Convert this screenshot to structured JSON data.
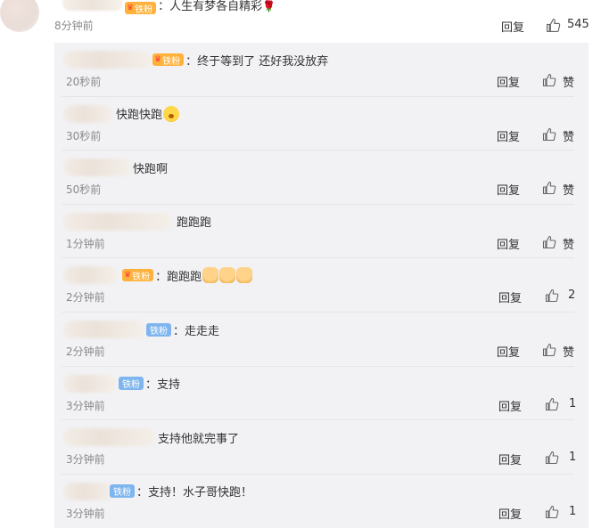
{
  "top_comment": {
    "badge": "铁粉",
    "text": "：人生有梦各自精彩",
    "emoji": "rose",
    "time": "8分钟前",
    "reply_label": "回复",
    "like_count": "545"
  },
  "replies": [
    {
      "badge_type": "fan",
      "badge": "铁粉",
      "text": "：终于等到了 还好我没放弃",
      "time": "20秒前",
      "reply_label": "回复",
      "like": "赞"
    },
    {
      "badge_type": "none",
      "text": "快跑快跑",
      "time": "30秒前",
      "reply_label": "回复",
      "like": "赞"
    },
    {
      "badge_type": "none",
      "text": "快跑啊",
      "time": "50秒前",
      "reply_label": "回复",
      "like": "赞"
    },
    {
      "badge_type": "none",
      "text": "跑跑跑",
      "time": "1分钟前",
      "reply_label": "回复",
      "like": "赞"
    },
    {
      "badge_type": "fan",
      "badge": "铁粉",
      "text": "：跑跑跑",
      "time": "2分钟前",
      "reply_label": "回复",
      "like": "2"
    },
    {
      "badge_type": "blue",
      "badge": "铁粉",
      "text": "：走走走",
      "time": "2分钟前",
      "reply_label": "回复",
      "like": "赞"
    },
    {
      "badge_type": "blue",
      "badge": "铁粉",
      "text": "：支持",
      "time": "3分钟前",
      "reply_label": "回复",
      "like": "1"
    },
    {
      "badge_type": "none",
      "text": "支持他就完事了",
      "time": "3分钟前",
      "reply_label": "回复",
      "like": "1"
    },
    {
      "badge_type": "blue",
      "badge": "铁粉",
      "text": "：支持！水子哥快跑！",
      "time": "3分钟前",
      "reply_label": "回复",
      "like": "1"
    }
  ],
  "colors": {
    "panel_bg": "#f2f2f5",
    "fan_badge": "#ffb23b",
    "blue_badge": "#7fb5ee",
    "meta_text": "#8a8a8a"
  },
  "icons": {
    "like": "thumbs-up-icon",
    "crown": "crown-icon",
    "rose": "rose-icon"
  }
}
